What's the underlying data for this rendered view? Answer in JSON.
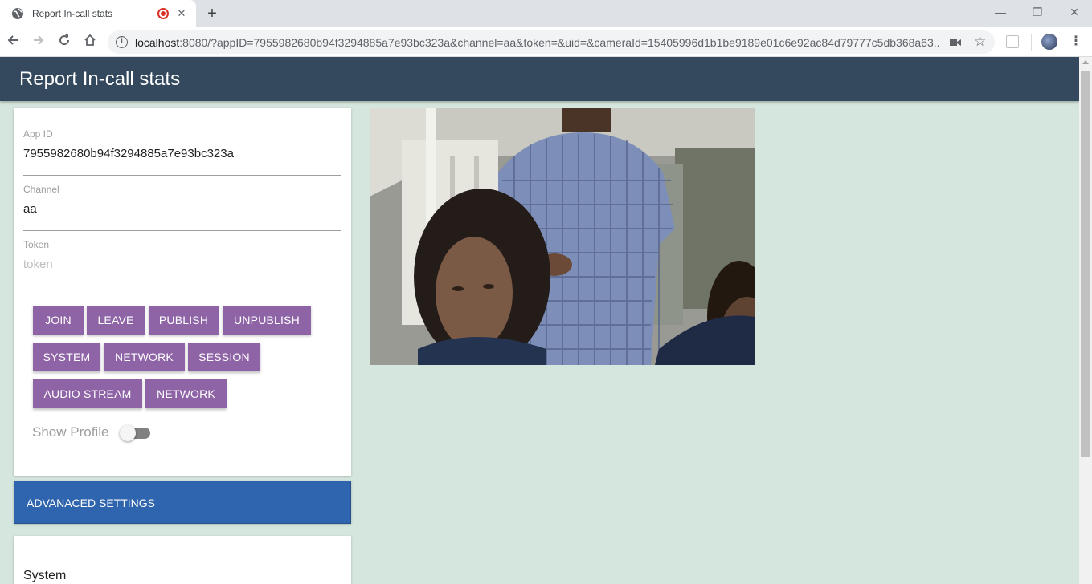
{
  "browser": {
    "tab_title": "Report In-call stats",
    "new_tab_glyph": "+",
    "tab_close_glyph": "✕",
    "url_host": "localhost",
    "url_rest": ":8080/?appID=7955982680b94f3294885a7e93bc323a&channel=aa&token=&uid=&cameraId=15405996d1b1be9189e01c6e92ac84d79777c5db368a63...",
    "icons": {
      "favicon": "globe-icon",
      "recording": "recording-dot-icon",
      "back": "arrow-left-icon",
      "forward": "arrow-right-icon",
      "reload": "reload-icon",
      "home": "home-icon",
      "site_info": "info-icon",
      "camera": "camera-icon",
      "bookmark": "star-icon",
      "menu": "more-vert-icon"
    },
    "window_controls": {
      "minimize": "—",
      "restore": "❐",
      "close": "✕"
    }
  },
  "app": {
    "header_title": "Report In-call stats",
    "colors": {
      "header": "#34495e",
      "background": "#d5e6de",
      "button": "#8e64a6",
      "advanced": "#2f64ae"
    }
  },
  "form": {
    "fields": [
      {
        "label": "App ID",
        "value": "7955982680b94f3294885a7e93bc323a",
        "placeholder": ""
      },
      {
        "label": "Channel",
        "value": "aa",
        "placeholder": ""
      },
      {
        "label": "Token",
        "value": "",
        "placeholder": "token"
      }
    ],
    "buttons_row1": [
      "JOIN",
      "LEAVE",
      "PUBLISH",
      "UNPUBLISH"
    ],
    "buttons_row2": [
      "SYSTEM",
      "NETWORK",
      "SESSION"
    ],
    "buttons_row3": [
      "AUDIO STREAM",
      "NETWORK"
    ],
    "show_profile_label": "Show Profile",
    "show_profile_on": false
  },
  "advanced_settings_label": "ADVANACED SETTINGS",
  "system_section_label": "System"
}
